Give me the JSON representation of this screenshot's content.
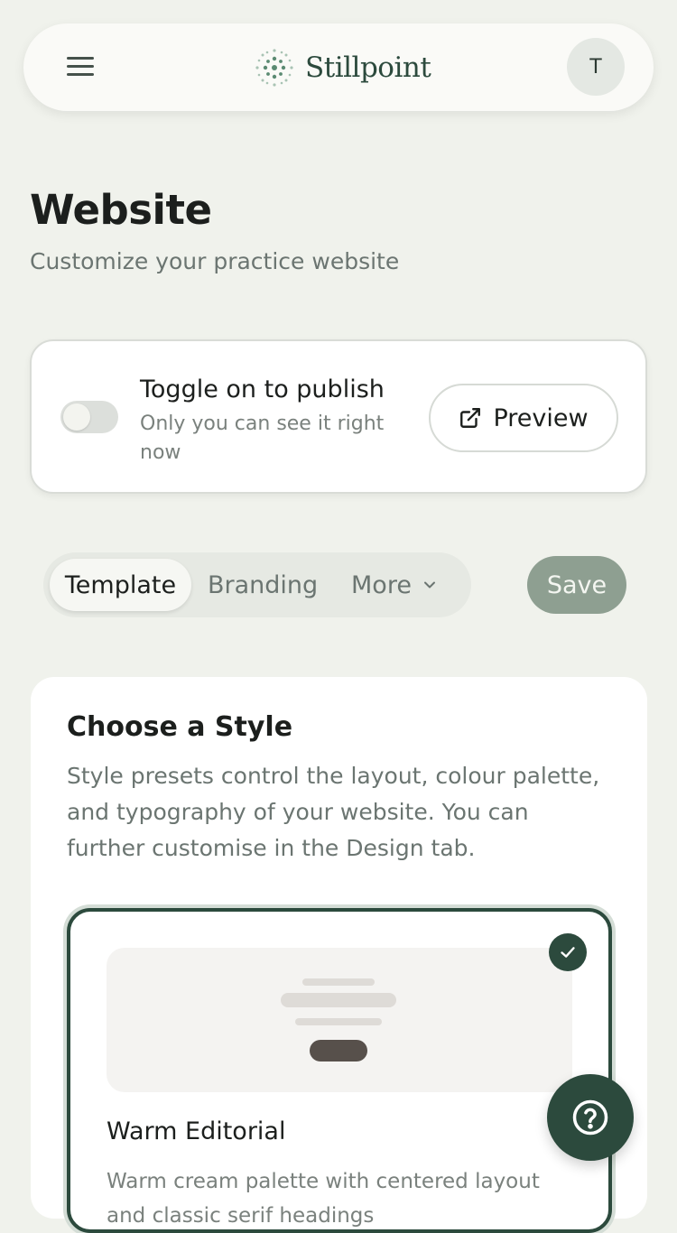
{
  "header": {
    "brand_name": "Stillpoint",
    "avatar_initial": "T"
  },
  "page": {
    "title": "Website",
    "subtitle": "Customize your practice website"
  },
  "publish": {
    "title": "Toggle on to publish",
    "subtitle": "Only you can see it right now",
    "toggle_on": false,
    "preview_label": "Preview"
  },
  "tabs": {
    "items": [
      "Template",
      "Branding",
      "More"
    ],
    "active": "Template",
    "save_label": "Save"
  },
  "style_section": {
    "title": "Choose a Style",
    "description": "Style presets control the layout, colour palette, and typography of your website. You can further customise in the Design tab.",
    "presets": [
      {
        "name": "Warm Editorial",
        "description": "Warm cream palette with centered layout and classic serif headings",
        "selected": true
      }
    ]
  },
  "colors": {
    "accent": "#2c4a3d",
    "background": "#f0f2ec",
    "save_button": "#8e9f91"
  }
}
